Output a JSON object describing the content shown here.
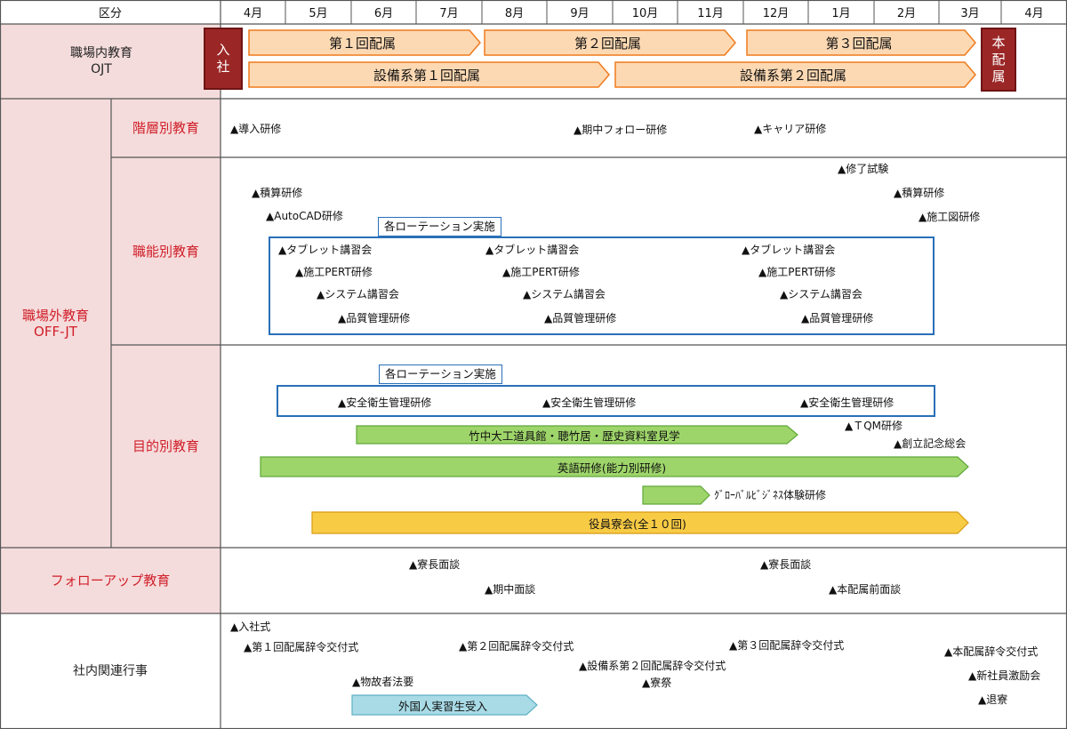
{
  "header": {
    "kubun": "区分",
    "months": [
      "4月",
      "5月",
      "6月",
      "7月",
      "8月",
      "9月",
      "10月",
      "11月",
      "12月",
      "1月",
      "2月",
      "3月",
      "4月"
    ]
  },
  "rows": {
    "ojt": "職場内教育\nOJT",
    "offjt": "職場外教育\nOFF-JT",
    "kaiso": "階層別教育",
    "shokuno": "職能別教育",
    "mokuteki": "目的別教育",
    "follow": "フォローアップ教育",
    "shanai": "社内関連行事"
  },
  "ojt": {
    "nyusha": "入\n社",
    "honhaizoku": "本\n配\n属",
    "haizoku1": "第１回配属",
    "haizoku2": "第２回配属",
    "haizoku3": "第３回配属",
    "setsubi1": "設備系第１回配属",
    "setsubi2": "設備系第２回配属"
  },
  "kaiso": [
    "▲導入研修",
    "▲期中フォロー研修",
    "▲キャリア研修"
  ],
  "shokuno": {
    "outside": [
      "▲積算研修",
      "▲AutoCAD研修",
      "▲修了試験",
      "▲積算研修",
      "▲施工図研修"
    ],
    "rotation_label": "各ローテーション実施",
    "rotation_items": [
      "▲タブレット講習会",
      "▲施工PERT研修",
      "▲システム講習会",
      "▲品質管理研修",
      "▲タブレット講習会",
      "▲施工PERT研修",
      "▲システム講習会",
      "▲品質管理研修",
      "▲タブレット講習会",
      "▲施工PERT研修",
      "▲システム講習会",
      "▲品質管理研修"
    ]
  },
  "mokuteki": {
    "rotation_label": "各ローテーション実施",
    "rotation_items": [
      "▲安全衛生管理研修",
      "▲安全衛生管理研修",
      "▲安全衛生管理研修"
    ],
    "events": [
      "▲ＴQM研修",
      "▲創立記念総会"
    ],
    "bars": [
      {
        "label": "竹中大工道具館・聴竹居・歴史資料室見学",
        "color": "#9ed56a",
        "border": "#5fa83a"
      },
      {
        "label": "英語研修(能力別研修)",
        "color": "#9ed56a",
        "border": "#5fa83a"
      },
      {
        "label": "",
        "color": "#9ed56a",
        "border": "#5fa83a"
      },
      {
        "label": "役員寮会(全１０回)",
        "color": "#f8cb45",
        "border": "#d89a14"
      }
    ],
    "global_label": "ｸﾞﾛｰﾊﾞﾙﾋﾞｼﾞﾈｽ体験研修"
  },
  "follow": [
    "▲寮長面談",
    "▲期中面談",
    "▲寮長面談",
    "▲本配属前面談"
  ],
  "shanai": {
    "events": [
      "▲入社式",
      "▲第１回配属辞令交付式",
      "▲第２回配属辞令交付式",
      "▲第３回配属辞令交付式",
      "▲本配属辞令交付式",
      "▲設備系第２回配属辞令交付式",
      "▲寮祭",
      "▲新社員激励会",
      "▲物故者法要",
      "▲退寮"
    ],
    "bar_label": "外国人実習生受入",
    "bar_color": "#a8dbe6"
  },
  "colors": {
    "label_bg": "#f5dcdc",
    "grid": "#555555",
    "ojt_fill": "#fdd9b3",
    "ojt_stroke": "#ef7a1c",
    "vbox": "#9b2626",
    "rotation": "#2a6fb8",
    "accent_red": "#d0202a"
  }
}
